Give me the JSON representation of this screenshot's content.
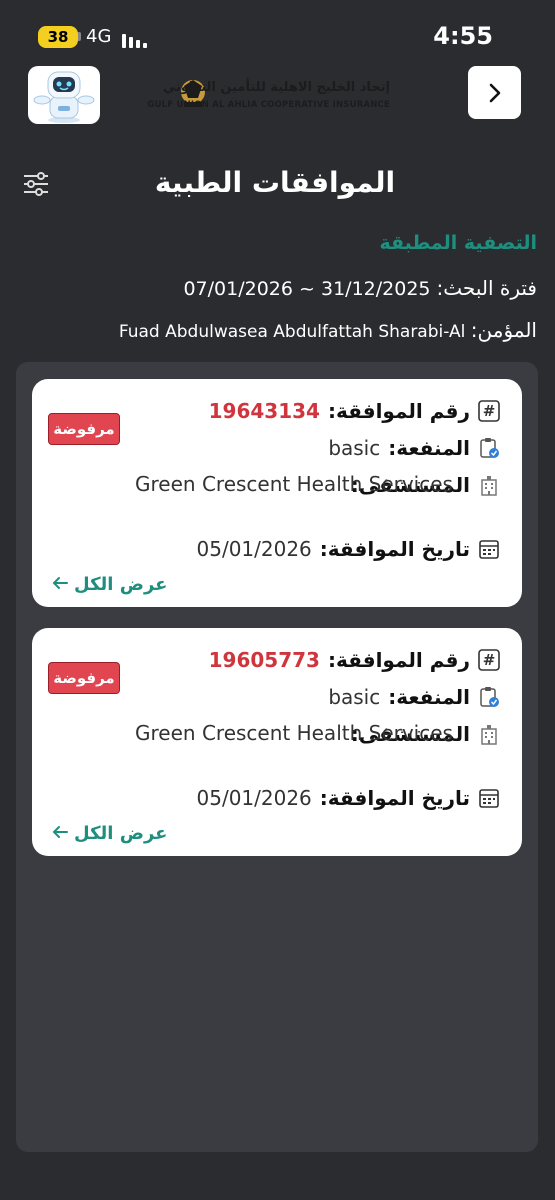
{
  "status_bar": {
    "battery": "38",
    "network": "4G",
    "time": "4:55"
  },
  "header": {
    "logo_ar": "إتحاد الخليج الاهلية للتأمين التعاوني",
    "logo_en": "GULF UNION AL AHLIA COOPERATIVE INSURANCE"
  },
  "page": {
    "title": "الموافقات الطبية"
  },
  "filters": {
    "applied_label": "التصفية المطبقة",
    "period_label": "فترة البحث:",
    "period_from": "31/12/2025",
    "period_sep": "~",
    "period_to": "07/01/2026",
    "insured_label": "المؤمن:",
    "insured_name": "Fuad Abdulwasea Abdulfattah Sharabi-Al"
  },
  "approvals": [
    {
      "number_label": "رقم الموافقة:",
      "number": "19643134",
      "status": "مرفوضة",
      "benefit_label": "المنفعة:",
      "benefit": "basic",
      "hospital_label": "المستشفى:",
      "hospital": "Green Crescent Health Services",
      "date_label": "تاريخ الموافقة:",
      "date": "05/01/2026",
      "view_all": "عرض الكل"
    },
    {
      "number_label": "رقم الموافقة:",
      "number": "19605773",
      "status": "مرفوضة",
      "benefit_label": "المنفعة:",
      "benefit": "basic",
      "hospital_label": "المستشفى:",
      "hospital": "Green Crescent Health Services",
      "date_label": "تاريخ الموافقة:",
      "date": "05/01/2026",
      "view_all": "عرض الكل"
    }
  ],
  "colors": {
    "accent": "#1e8f7e",
    "reject": "#e04550",
    "number": "#d0343d",
    "background": "#2b2c30"
  }
}
